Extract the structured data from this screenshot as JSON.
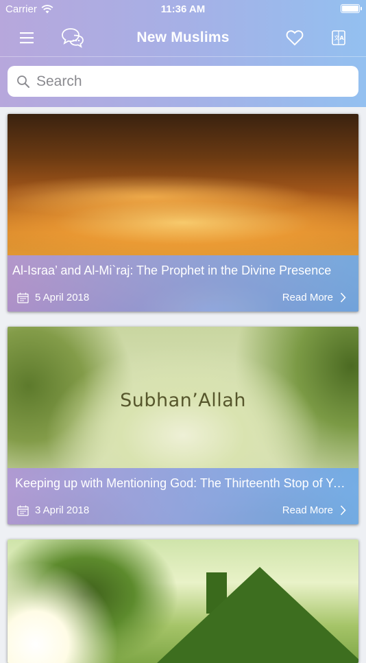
{
  "status_bar": {
    "carrier": "Carrier",
    "time": "11:36 AM"
  },
  "navbar": {
    "title": "New Muslims",
    "icons": [
      "menu-icon",
      "chat-bubbles-icon",
      "heart-icon",
      "translate-icon"
    ]
  },
  "search": {
    "placeholder": "Search",
    "value": ""
  },
  "articles": [
    {
      "title": "Al-Israa’ and Al-Mi`raj: The Prophet in the Divine Presence",
      "date": "5 April 2018",
      "read_more": "Read More"
    },
    {
      "title": "Keeping up with Mentioning God: The Thirteenth Stop of Your Journey",
      "date": "3 April 2018",
      "read_more": "Read More",
      "image_text": "Subhan’Allah"
    },
    {
      "title": "",
      "date": "",
      "read_more": ""
    }
  ],
  "colors": {
    "header_gradient_start": "#b7a7dc",
    "header_gradient_end": "#93c0f0",
    "text_on_header": "#ffffff"
  }
}
